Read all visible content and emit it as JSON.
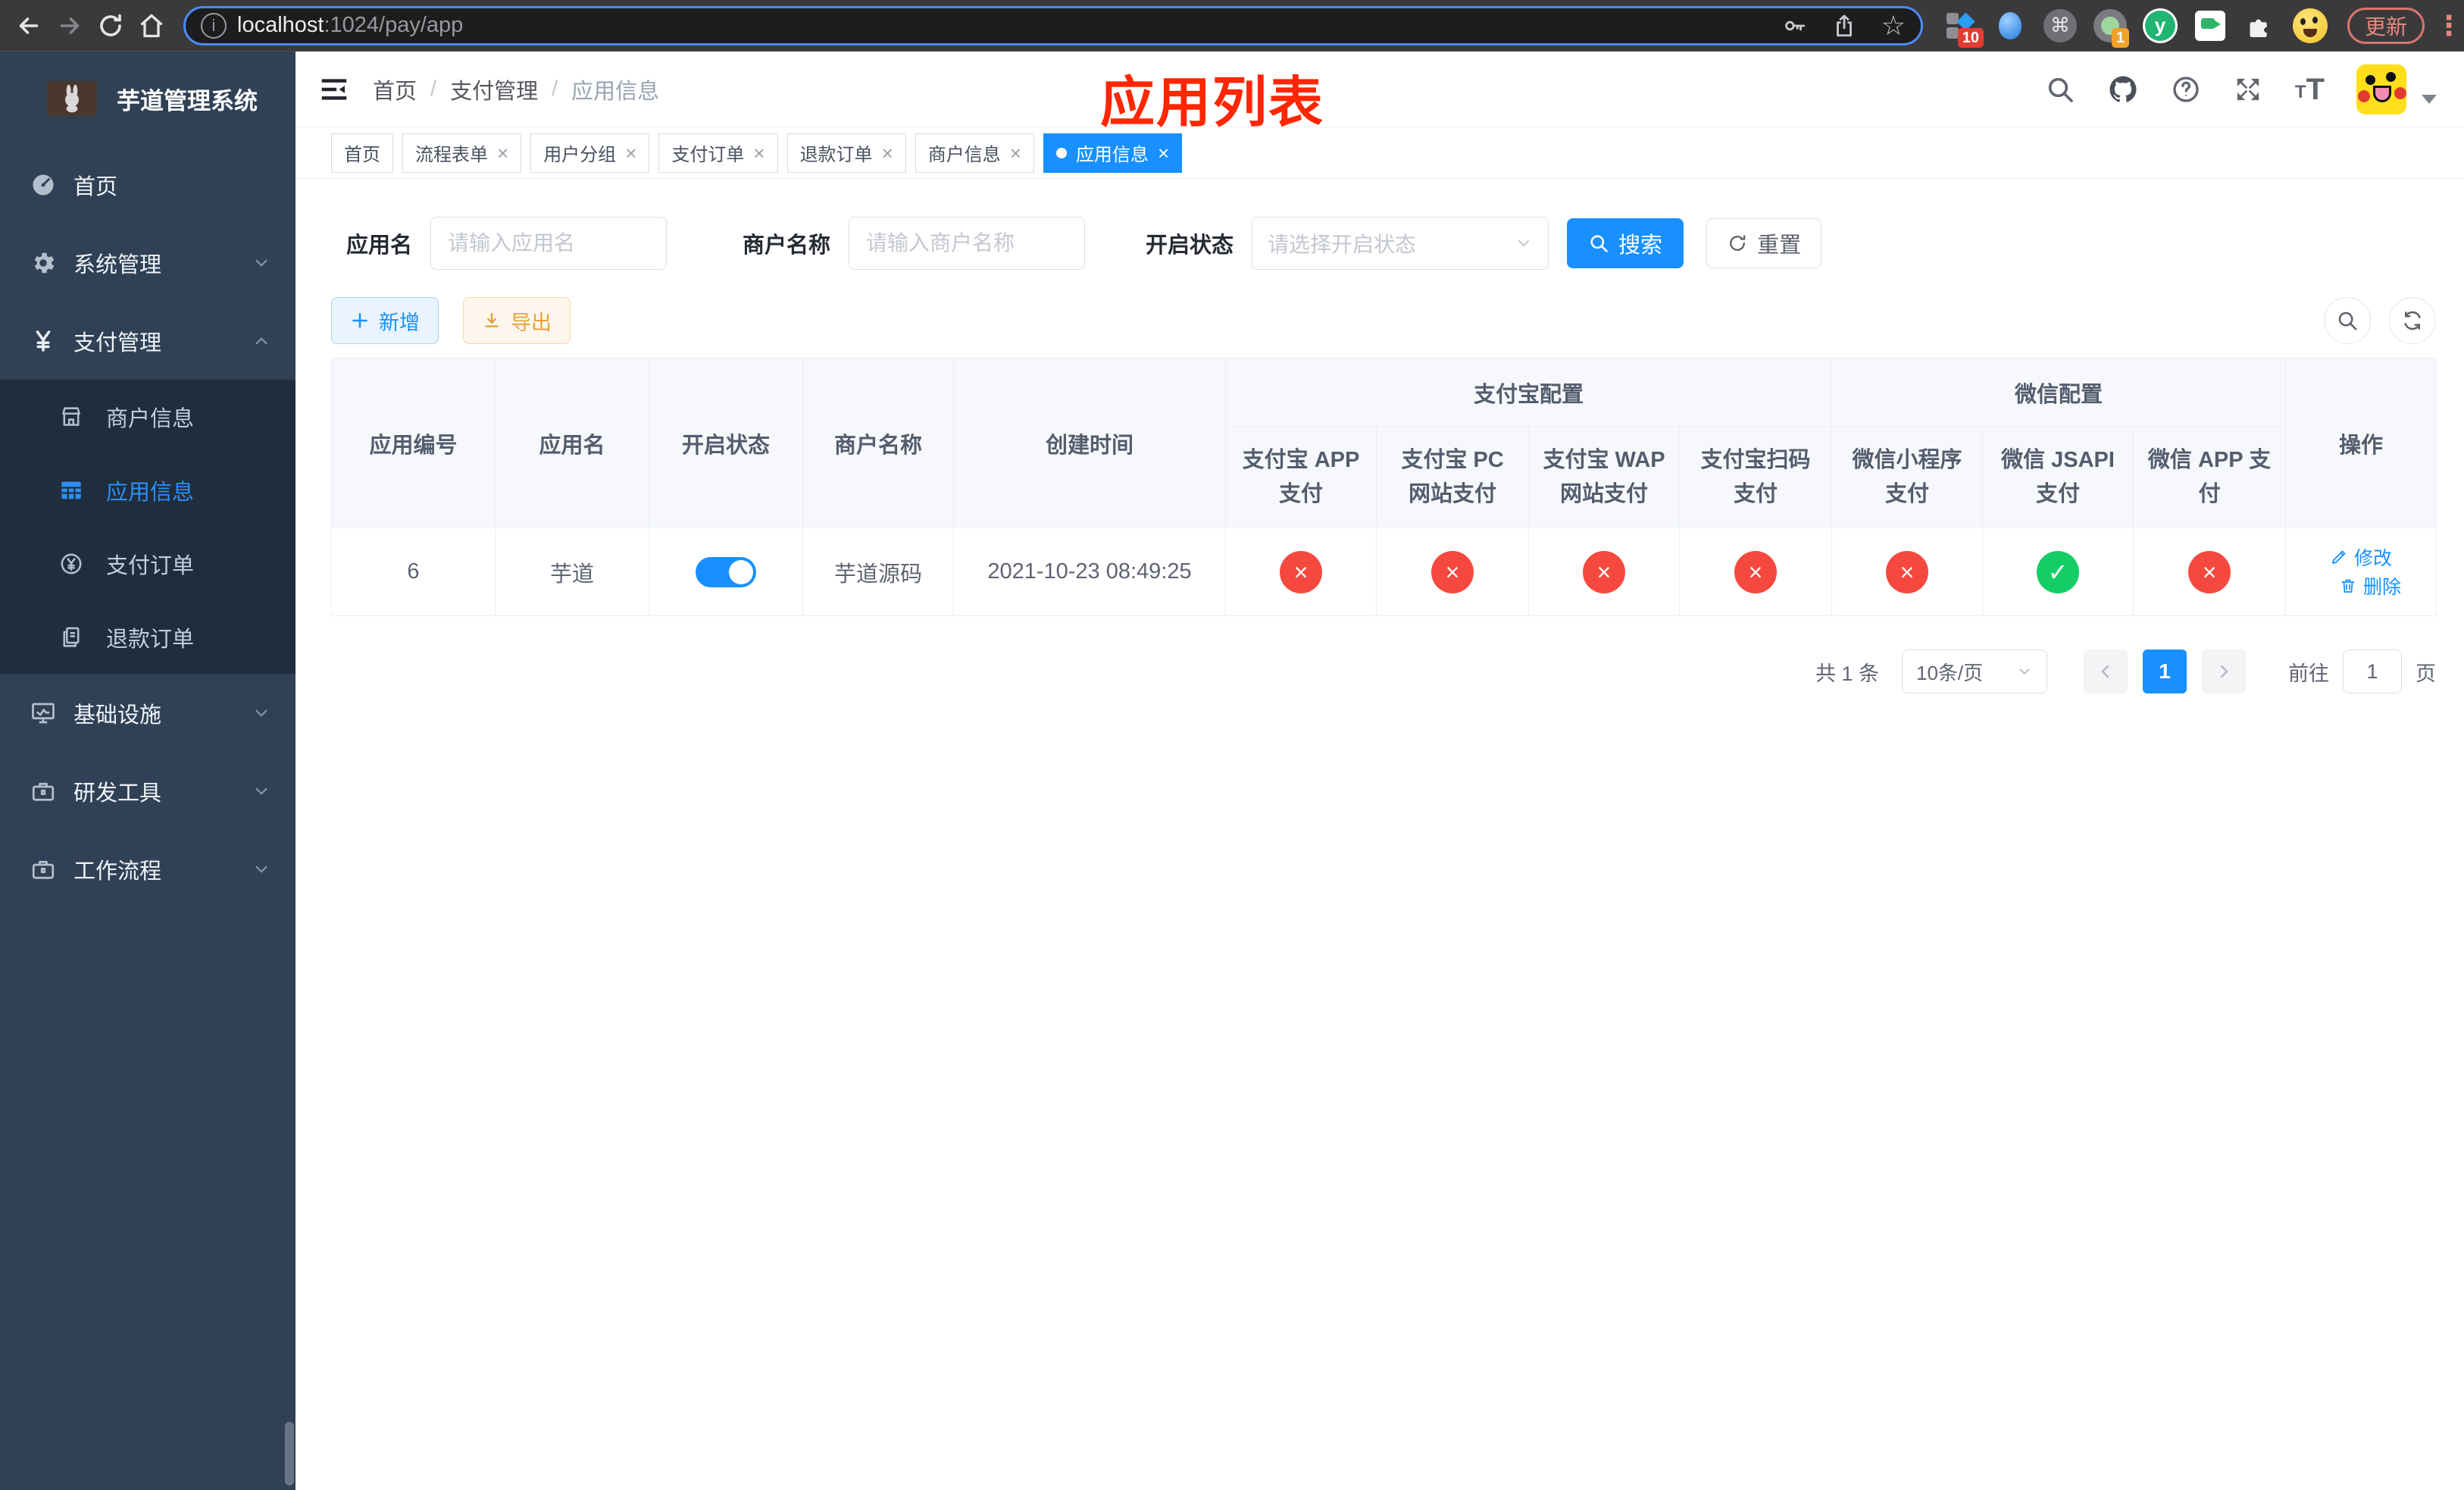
{
  "browser": {
    "url_host": "localhost",
    "url_path": ":1024/pay/app",
    "update_label": "更新",
    "ext_badge_1": "10",
    "ext_badge_2": "1"
  },
  "icons": {
    "close": "×",
    "check": "✓",
    "star": "☆",
    "more_vertical": "⋮",
    "command": "⌘",
    "ext_y": "y",
    "info": "i",
    "question": "?",
    "font_small": "T",
    "font_big": "T"
  },
  "sidebar": {
    "title": "芋道管理系统",
    "top_items": [
      {
        "label": "首页"
      },
      {
        "label": "系统管理"
      },
      {
        "label": "支付管理"
      }
    ],
    "payment_children": [
      {
        "label": "商户信息"
      },
      {
        "label": "应用信息"
      },
      {
        "label": "支付订单"
      },
      {
        "label": "退款订单"
      }
    ],
    "bottom_items": [
      {
        "label": "基础设施"
      },
      {
        "label": "研发工具"
      },
      {
        "label": "工作流程"
      }
    ],
    "active_item": "应用信息"
  },
  "breadcrumb": {
    "separator": "/",
    "items": [
      "首页",
      "支付管理",
      "应用信息"
    ]
  },
  "annotation": "应用列表",
  "tabs": [
    {
      "label": "首页",
      "closable": false,
      "active": false
    },
    {
      "label": "流程表单",
      "closable": true,
      "active": false
    },
    {
      "label": "用户分组",
      "closable": true,
      "active": false
    },
    {
      "label": "支付订单",
      "closable": true,
      "active": false
    },
    {
      "label": "退款订单",
      "closable": true,
      "active": false
    },
    {
      "label": "商户信息",
      "closable": true,
      "active": false
    },
    {
      "label": "应用信息",
      "closable": true,
      "active": true
    }
  ],
  "filters": {
    "app_name_label": "应用名",
    "app_name_placeholder": "请输入应用名",
    "merchant_label": "商户名称",
    "merchant_placeholder": "请输入商户名称",
    "status_label": "开启状态",
    "status_placeholder": "请选择开启状态",
    "search_label": "搜索",
    "reset_label": "重置"
  },
  "toolbar": {
    "add_label": "新增",
    "export_label": "导出"
  },
  "table": {
    "group_headers": {
      "alipay": "支付宝配置",
      "wechat": "微信配置"
    },
    "columns": [
      "应用编号",
      "应用名",
      "开启状态",
      "商户名称",
      "创建时间",
      "支付宝 APP 支付",
      "支付宝 PC 网站支付",
      "支付宝 WAP 网站支付",
      "支付宝扫码支付",
      "微信小程序支付",
      "微信 JSAPI 支付",
      "微信 APP 支付",
      "操作"
    ],
    "row": {
      "id": "6",
      "name": "芋道",
      "enabled": true,
      "merchant_name": "芋道源码",
      "create_time": "2021-10-23 08:49:25",
      "payment_status": [
        false,
        false,
        false,
        false,
        false,
        true,
        false
      ],
      "edit_label": "修改",
      "delete_label": "删除"
    }
  },
  "pagination": {
    "total": "共 1 条",
    "page_size": "10条/页",
    "current_page": "1",
    "goto_label": "前往",
    "goto_value": "1",
    "unit_label": "页"
  },
  "colors": {
    "primary": "#1890ff",
    "sidebar_bg": "#304156",
    "submenu_bg": "#1f2d3d",
    "active_text": "#2d8ff7",
    "danger": "#f5493f",
    "success": "#13ce66",
    "warning": "#e6a23c",
    "annotation": "#ff2600"
  }
}
